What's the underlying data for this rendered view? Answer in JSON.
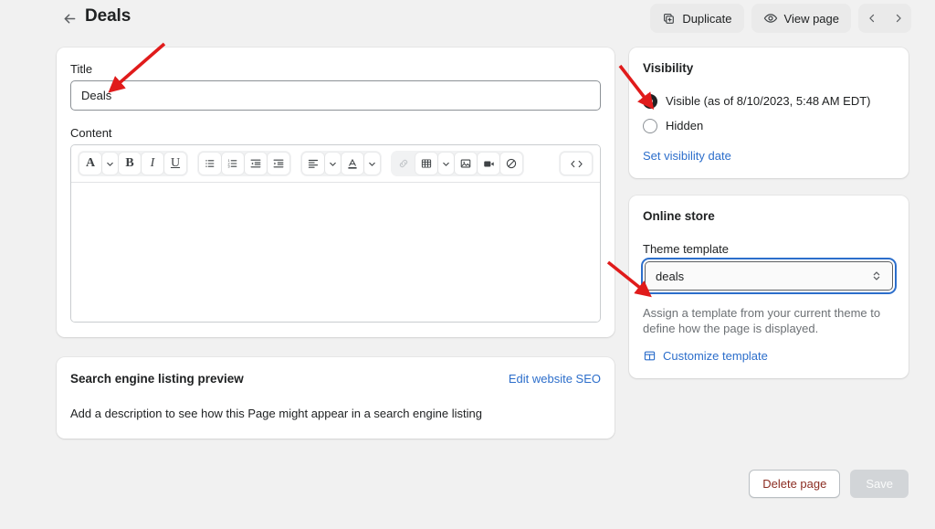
{
  "header": {
    "back_icon": "arrow-left-icon",
    "title": "Deals",
    "duplicate_label": "Duplicate",
    "duplicate_icon": "duplicate-icon",
    "view_page_label": "View page",
    "view_page_icon": "eye-icon",
    "prev_icon": "chevron-left-icon",
    "next_icon": "chevron-right-icon"
  },
  "main": {
    "title_label": "Title",
    "title_value": "Deals",
    "content_label": "Content",
    "editor": {
      "toolbar": [
        {
          "name": "font-style-button",
          "glyph": "A",
          "type": "serif"
        },
        {
          "name": "font-style-caret-icon",
          "glyph": "chevron-down-icon"
        },
        {
          "name": "bold-button",
          "glyph": "B"
        },
        {
          "name": "italic-button",
          "glyph": "I"
        },
        {
          "name": "underline-button",
          "glyph": "U"
        },
        {
          "name": "bulleted-list-button",
          "glyph": "bulleted-list-icon"
        },
        {
          "name": "numbered-list-button",
          "glyph": "numbered-list-icon"
        },
        {
          "name": "outdent-button",
          "glyph": "outdent-icon"
        },
        {
          "name": "indent-button",
          "glyph": "indent-icon"
        },
        {
          "name": "align-button",
          "glyph": "align-left-icon"
        },
        {
          "name": "align-caret-icon",
          "glyph": "chevron-down-icon"
        },
        {
          "name": "text-color-button",
          "glyph": "text-color-icon"
        },
        {
          "name": "text-color-caret-icon",
          "glyph": "chevron-down-icon"
        },
        {
          "name": "insert-link-button",
          "glyph": "link-icon",
          "disabled": true
        },
        {
          "name": "insert-table-button",
          "glyph": "table-icon"
        },
        {
          "name": "table-caret-icon",
          "glyph": "chevron-down-icon"
        },
        {
          "name": "insert-image-button",
          "glyph": "image-icon"
        },
        {
          "name": "insert-video-button",
          "glyph": "video-icon"
        },
        {
          "name": "clear-formatting-button",
          "glyph": "no-entry-icon"
        },
        {
          "name": "show-html-button",
          "glyph": "code-icon"
        }
      ],
      "body_value": ""
    },
    "seo": {
      "title": "Search engine listing preview",
      "edit_link": "Edit website SEO",
      "description": "Add a description to see how this Page might appear in a search engine listing"
    }
  },
  "sidebar": {
    "visibility": {
      "title": "Visibility",
      "options": [
        {
          "label": "Visible (as of 8/10/2023, 5:48 AM EDT)",
          "selected": true
        },
        {
          "label": "Hidden",
          "selected": false
        }
      ],
      "set_date_link": "Set visibility date"
    },
    "online_store": {
      "title": "Online store",
      "template_label": "Theme template",
      "template_value": "deals",
      "select_icon": "up-down-chevron-icon",
      "help_text": "Assign a template from your current theme to define how the page is displayed.",
      "customize_link": "Customize template",
      "customize_icon": "template-icon"
    }
  },
  "footer": {
    "delete_label": "Delete page",
    "save_label": "Save",
    "save_disabled": true
  },
  "colors": {
    "page_background": "#f1f1f1",
    "card_background": "#ffffff",
    "accent_link": "#2c6ecb",
    "focus_ring": "#2c6ecb",
    "delete_text": "#8c2d22",
    "annotation_arrow": "#e01b1b"
  },
  "annotations": {
    "arrow_count": 3,
    "arrow_color": "#e01b1b",
    "targets": [
      "title-input",
      "visibility-visible-radio",
      "theme-template-select"
    ]
  }
}
